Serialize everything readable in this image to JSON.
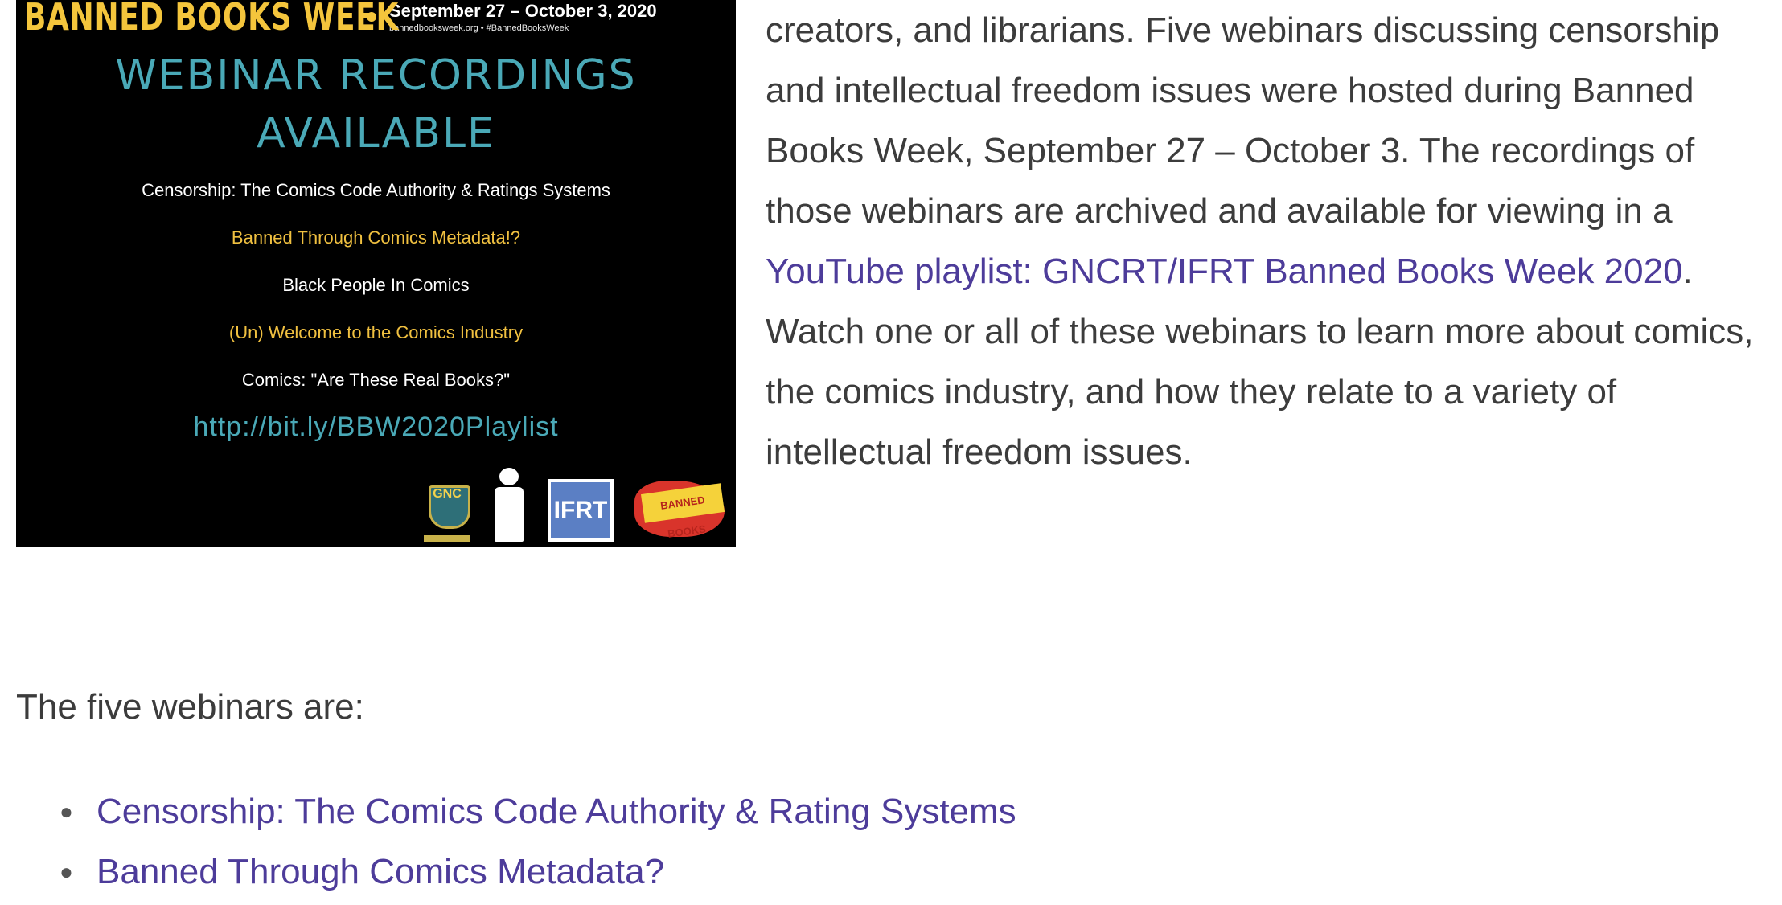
{
  "poster": {
    "brand": "BANNED BOOKS WEEK",
    "date_range": "September 27 – October 3, 2020",
    "site": "bannedbooksweek.org • #BannedBooksWeek",
    "headline_line1": "WEBINAR RECORDINGS",
    "headline_line2": "AVAILABLE",
    "items": [
      "Censorship: The Comics Code Authority & Ratings Systems",
      "Banned Through Comics Metadata!?",
      "Black People In Comics",
      "(Un) Welcome to the Comics Industry",
      "Comics: \"Are These Real Books?\""
    ],
    "url": "http://bit.ly/BBW2020Playlist",
    "logo_gnc_label": "GNC",
    "logo_ifrt_label": "IFRT",
    "logo_banned_label": "BANNED BOOKS"
  },
  "paragraph": {
    "text_before_link": "creators, and librarians. Five webinars discussing censorship and intellectual freedom issues were hosted during Banned Books Week, September 27 – October 3. The recordings of those webinars are archived and available for viewing in a ",
    "link_text": "YouTube playlist: GNCRT/IFRT Banned Books Week 2020",
    "text_after_link": ". Watch one or all of these webinars to learn more about comics, the comics industry, and how they relate to a variety of intellectual freedom issues."
  },
  "intro": "The five webinars are:",
  "webinars": [
    "Censorship: The Comics Code Authority & Rating Systems",
    "Banned Through Comics Metadata?"
  ],
  "colors": {
    "link": "#4d3c9a",
    "body_text": "#3c3c3c",
    "poster_bg": "#000000",
    "poster_teal": "#4aa9b7",
    "poster_gold": "#f0c040"
  }
}
